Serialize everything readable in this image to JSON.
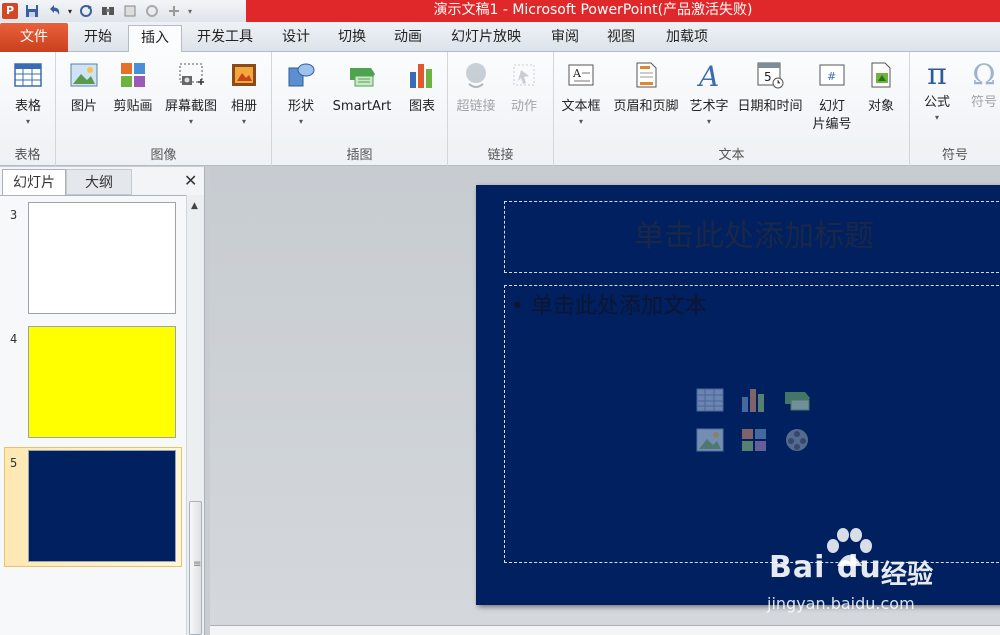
{
  "window": {
    "title": "演示文稿1 - Microsoft PowerPoint(产品激活失败)",
    "app_logo_letter": "P"
  },
  "tabs": [
    {
      "label": "文件"
    },
    {
      "label": "开始"
    },
    {
      "label": "插入"
    },
    {
      "label": "开发工具"
    },
    {
      "label": "设计"
    },
    {
      "label": "切换"
    },
    {
      "label": "动画"
    },
    {
      "label": "幻灯片放映"
    },
    {
      "label": "审阅"
    },
    {
      "label": "视图"
    },
    {
      "label": "加载项"
    }
  ],
  "ribbon": {
    "groups": {
      "table": "表格",
      "images": "图像",
      "illustrations": "插图",
      "links": "链接",
      "text": "文本",
      "symbols": "符号"
    },
    "buttons": {
      "table": "表格",
      "picture": "图片",
      "clipart": "剪贴画",
      "screenshot": "屏幕截图",
      "album": "相册",
      "shapes": "形状",
      "smartart": "SmartArt",
      "chart": "图表",
      "hyperlink": "超链接",
      "action": "动作",
      "textbox": "文本框",
      "header_footer": "页眉和页脚",
      "wordart": "艺术字",
      "datetime": "日期和时间",
      "slide_number_1": "幻灯",
      "slide_number_2": "片编号",
      "object": "对象",
      "equation": "公式",
      "symbol": "符号",
      "datetime_icon_digit": "5",
      "slide_number_icon_mark": "#",
      "textbox_icon_letter": "A",
      "wordart_icon_letter": "A",
      "equation_icon": "π",
      "symbol_icon": "Ω"
    }
  },
  "panel": {
    "tab_slides": "幻灯片",
    "tab_outline": "大纲",
    "close": "✕",
    "slides": [
      {
        "number": "3",
        "color": "#ffffff"
      },
      {
        "number": "4",
        "color": "#ffff00"
      },
      {
        "number": "5",
        "color": "#002060"
      }
    ]
  },
  "slide": {
    "title_placeholder": "单击此处添加标题",
    "body_placeholder": "单击此处添加文本",
    "bullet": "•",
    "background": "#002060"
  },
  "watermark": {
    "logo_text": "Bai du",
    "cn_text": "经验",
    "url": "jingyan.baidu.com"
  },
  "colors": {
    "title_bar_red": "#e0282a",
    "file_tab": "#d24726"
  }
}
